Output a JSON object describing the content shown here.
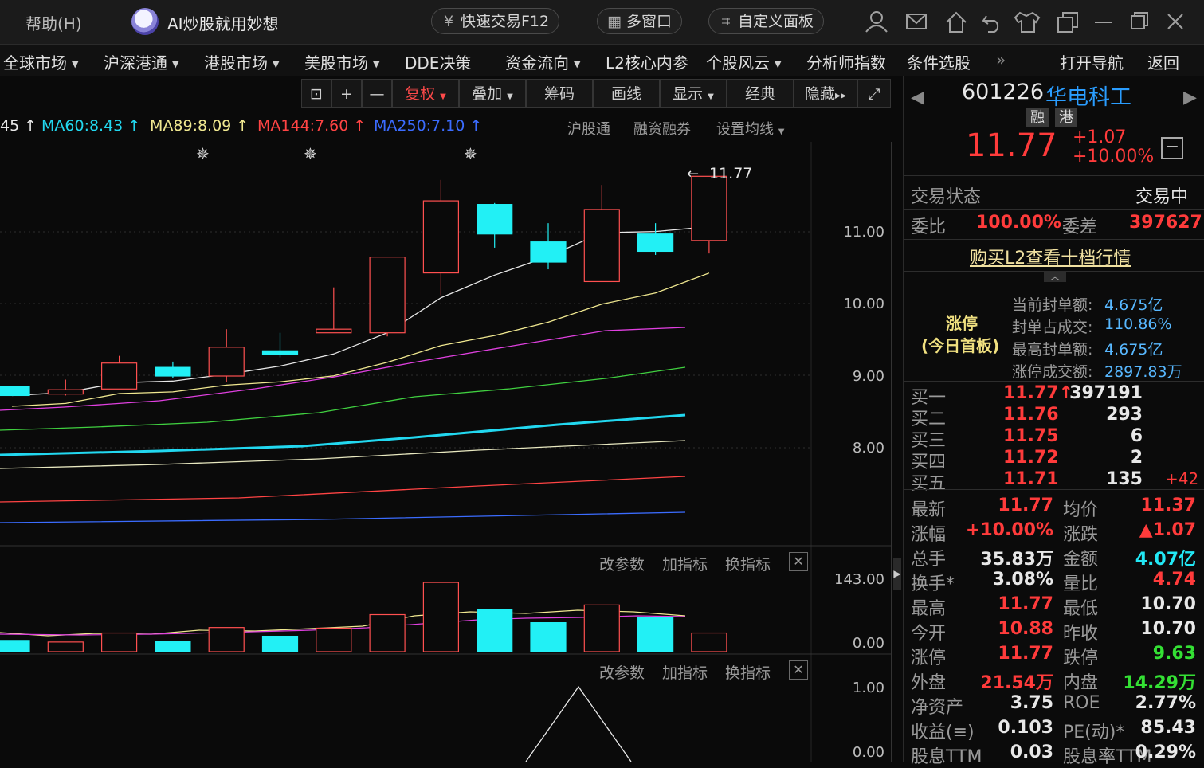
{
  "titlebar": {
    "help": "帮助(H)",
    "ai_title": "AI炒股就用妙想",
    "buttons": [
      {
        "icon": "¥",
        "label": "快速交易F12"
      },
      {
        "icon": "▦",
        "label": "多窗口"
      },
      {
        "icon": "⌗",
        "label": "自定义面板"
      }
    ]
  },
  "menu": [
    "全球市场",
    "沪深港通",
    "港股市场",
    "美股市场",
    "DDE决策",
    "资金流向",
    "L2核心内参",
    "个股风云",
    "分析师指数",
    "条件选股",
    "»",
    "打开导航",
    "返回"
  ],
  "toolbar": [
    "复权",
    "叠加",
    "筹码",
    "画线",
    "显示",
    "经典",
    "隐藏"
  ],
  "ma_legend": [
    {
      "text": "45 ↑",
      "color": "#e8e8e8"
    },
    {
      "text": "MA60:8.43 ↑",
      "color": "#22d8f0"
    },
    {
      "text": "MA89:8.09 ↑",
      "color": "#f0e890"
    },
    {
      "text": "MA144:7.60 ↑",
      "color": "#ff4444"
    },
    {
      "text": "MA250:7.10 ↑",
      "color": "#3b6cff"
    }
  ],
  "chart_tools": [
    "沪股通",
    "融资融券",
    "设置均线"
  ],
  "price_axis": [
    "11.00",
    "10.00",
    "9.00",
    "8.00"
  ],
  "last_price_label": "11.77",
  "volume_axis": [
    "143.00",
    "0.00"
  ],
  "indicator_axis": [
    "1.00",
    "0.00"
  ],
  "panel_controls": [
    "改参数",
    "加指标",
    "换指标"
  ],
  "chart_data": {
    "type": "candlestick",
    "candles": [
      {
        "o": 8.85,
        "c": 8.73,
        "h": 8.85,
        "l": 8.73
      },
      {
        "o": 8.75,
        "c": 8.81,
        "h": 8.95,
        "l": 8.73
      },
      {
        "o": 8.82,
        "c": 9.18,
        "h": 9.28,
        "l": 8.82
      },
      {
        "o": 9.12,
        "c": 9.0,
        "h": 9.2,
        "l": 8.97
      },
      {
        "o": 9.0,
        "c": 9.4,
        "h": 9.65,
        "l": 8.92
      },
      {
        "o": 9.35,
        "c": 9.3,
        "h": 9.6,
        "l": 9.26
      },
      {
        "o": 9.6,
        "c": 9.65,
        "h": 10.23,
        "l": 9.6
      },
      {
        "o": 9.6,
        "c": 10.65,
        "h": 10.65,
        "l": 9.55
      },
      {
        "o": 10.43,
        "c": 11.43,
        "h": 11.72,
        "l": 10.12
      },
      {
        "o": 11.38,
        "c": 10.97,
        "h": 11.4,
        "l": 10.78
      },
      {
        "o": 10.86,
        "c": 10.58,
        "h": 11.12,
        "l": 10.48
      },
      {
        "o": 10.31,
        "c": 11.31,
        "h": 11.65,
        "l": 10.31
      },
      {
        "o": 10.97,
        "c": 10.73,
        "h": 11.12,
        "l": 10.68
      },
      {
        "o": 10.88,
        "c": 11.77,
        "h": 11.77,
        "l": 10.7
      }
    ],
    "volume": [
      35,
      30,
      58,
      32,
      75,
      48,
      73,
      115,
      215,
      130,
      90,
      145,
      105,
      58
    ],
    "ylim": [
      7.2,
      12.2
    ]
  },
  "stock": {
    "code": "601226",
    "name": "华电科工",
    "tags": [
      "融",
      "港"
    ],
    "price": "11.77",
    "change": "+1.07",
    "change_pct": "+10.00%",
    "status_label": "交易状态",
    "status_value": "交易中",
    "weibi_label": "委比",
    "weibi_value": "100.00%",
    "weicha_label": "委差",
    "weicha_value": "397627",
    "buy_l2": "购买L2查看十档行情",
    "limit_title": "涨停",
    "limit_sub": "(今日首板)",
    "limit_stats": [
      {
        "label": "当前封单额:",
        "value": "4.675亿"
      },
      {
        "label": "封单占成交:",
        "value": "110.86%"
      },
      {
        "label": "最高封单额:",
        "value": "4.675亿"
      },
      {
        "label": "涨停成交额:",
        "value": "2897.83万"
      }
    ],
    "bids": [
      {
        "label": "买一",
        "price": "11.77↑",
        "vol": "397191",
        "extra": ""
      },
      {
        "label": "买二",
        "price": "11.76",
        "vol": "293",
        "extra": ""
      },
      {
        "label": "买三",
        "price": "11.75",
        "vol": "6",
        "extra": ""
      },
      {
        "label": "买四",
        "price": "11.72",
        "vol": "2",
        "extra": ""
      },
      {
        "label": "买五",
        "price": "11.71",
        "vol": "135",
        "extra": "+42"
      }
    ],
    "stats": [
      {
        "l1": "最新",
        "v1": "11.77",
        "c1": "red",
        "l2": "均价",
        "v2": "11.37",
        "c2": "red"
      },
      {
        "l1": "涨幅",
        "v1": "+10.00%",
        "c1": "red",
        "l2": "涨跌",
        "v2": "▲1.07",
        "c2": "red"
      },
      {
        "l1": "总手",
        "v1": "35.83万",
        "c1": "white",
        "l2": "金额",
        "v2": "4.07亿",
        "c2": "cyan"
      },
      {
        "l1": "换手*",
        "v1": "3.08%",
        "c1": "white",
        "l2": "量比",
        "v2": "4.74",
        "c2": "red"
      },
      {
        "l1": "最高",
        "v1": "11.77",
        "c1": "red",
        "l2": "最低",
        "v2": "10.70",
        "c2": "white"
      },
      {
        "l1": "今开",
        "v1": "10.88",
        "c1": "red",
        "l2": "昨收",
        "v2": "10.70",
        "c2": "white"
      },
      {
        "l1": "涨停",
        "v1": "11.77",
        "c1": "red",
        "l2": "跌停",
        "v2": "9.63",
        "c2": "green"
      },
      {
        "l1": "外盘",
        "v1": "21.54万",
        "c1": "red",
        "l2": "内盘",
        "v2": "14.29万",
        "c2": "green"
      },
      {
        "l1": "净资产",
        "v1": "3.75",
        "c1": "white",
        "l2": "ROE",
        "v2": "2.77%",
        "c2": "white"
      },
      {
        "l1": "收益(≡)",
        "v1": "0.103",
        "c1": "white",
        "l2": "PE(动)*",
        "v2": "85.43",
        "c2": "white"
      },
      {
        "l1": "股息TTM",
        "v1": "0.03",
        "c1": "white",
        "l2": "股息率TTM",
        "v2": "0.29%",
        "c2": "white"
      }
    ]
  }
}
